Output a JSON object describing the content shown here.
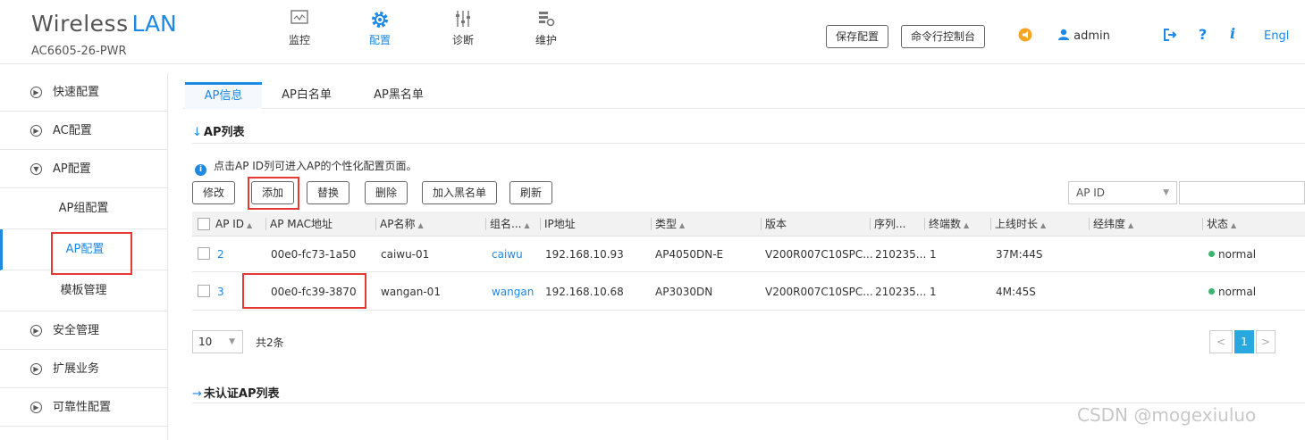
{
  "brand": {
    "word1": "Wireless",
    "word2": "LAN",
    "model": "AC6605-26-PWR"
  },
  "topnav": [
    {
      "label": "监控",
      "icon": "monitor-icon"
    },
    {
      "label": "配置",
      "icon": "gear-icon",
      "active": true
    },
    {
      "label": "诊断",
      "icon": "sliders-icon"
    },
    {
      "label": "维护",
      "icon": "maintenance-icon"
    }
  ],
  "header": {
    "save_config": "保存配置",
    "cli_console": "命令行控制台",
    "user": "admin",
    "lang": "Engl"
  },
  "sidebar": {
    "items": [
      {
        "label": "快速配置"
      },
      {
        "label": "AC配置"
      },
      {
        "label": "AP配置"
      },
      {
        "label": "安全管理"
      },
      {
        "label": "扩展业务"
      },
      {
        "label": "可靠性配置"
      }
    ],
    "sub": [
      {
        "label": "AP组配置"
      },
      {
        "label": "AP配置",
        "active": true
      },
      {
        "label": "模板管理"
      }
    ]
  },
  "tabs": [
    {
      "label": "AP信息",
      "active": true
    },
    {
      "label": "AP白名单"
    },
    {
      "label": "AP黑名单"
    }
  ],
  "section_ap_list": "AP列表",
  "section_unauth": "未认证AP列表",
  "hint": "点击AP ID列可进入AP的个性化配置页面。",
  "toolbar": {
    "modify": "修改",
    "add": "添加",
    "replace": "替换",
    "delete": "删除",
    "blacklist": "加入黑名单",
    "refresh": "刷新"
  },
  "filter": {
    "field": "AP ID",
    "value": ""
  },
  "table": {
    "headers": [
      "AP ID",
      "AP MAC地址",
      "AP名称",
      "组名...",
      "IP地址",
      "类型",
      "版本",
      "序列...",
      "终端数",
      "上线时长",
      "经纬度",
      "状态"
    ],
    "rows": [
      {
        "id": "2",
        "mac": "00e0-fc73-1a50",
        "name": "caiwu-01",
        "group": "caiwu",
        "ip": "192.168.10.93",
        "type": "AP4050DN-E",
        "version": "V200R007C10SPC...",
        "serial": "210235...",
        "clients": "1",
        "uptime": "37M:44S",
        "geo": "",
        "status": "normal"
      },
      {
        "id": "3",
        "mac": "00e0-fc39-3870",
        "name": "wangan-01",
        "group": "wangan",
        "ip": "192.168.10.68",
        "type": "AP3030DN",
        "version": "V200R007C10SPC...",
        "serial": "210235...",
        "clients": "1",
        "uptime": "4M:45S",
        "geo": "",
        "status": "normal"
      }
    ]
  },
  "pager": {
    "page_size": "10",
    "total": "共2条",
    "current": "1",
    "prev": "<",
    "next": ">"
  },
  "watermark": "CSDN @mogexiuluo"
}
